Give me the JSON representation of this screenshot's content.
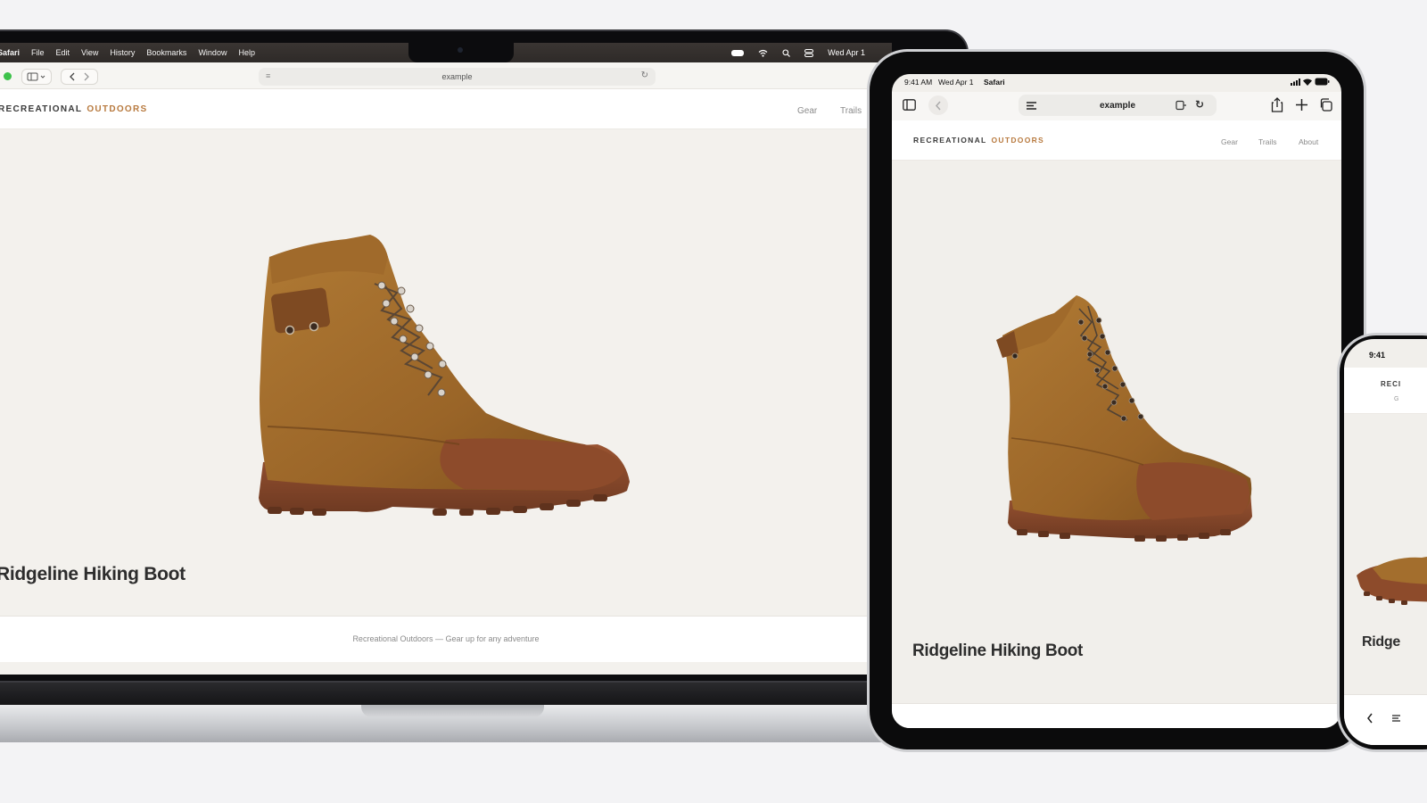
{
  "macbook": {
    "menubar": {
      "items": [
        "Safari",
        "File",
        "Edit",
        "View",
        "History",
        "Bookmarks",
        "Window",
        "Help"
      ],
      "clock": "Wed Apr 1"
    },
    "safari": {
      "url": "example"
    },
    "site": {
      "logo_main": "RECREATIONAL",
      "logo_accent": "OUTDOORS",
      "nav": [
        "Gear",
        "Trails"
      ],
      "product_title": "Ridgeline Hiking Boot",
      "footer": "Recreational Outdoors — Gear up for any adventure"
    }
  },
  "ipad": {
    "status": {
      "time": "9:41 AM",
      "date": "Wed Apr 1",
      "app": "Safari"
    },
    "safari": {
      "url": "example"
    },
    "site": {
      "logo_main": "RECREATIONAL",
      "logo_accent": "OUTDOORS",
      "nav": [
        "Gear",
        "Trails",
        "About"
      ],
      "product_title": "Ridgeline Hiking Boot"
    }
  },
  "iphone": {
    "status": {
      "time": "9:41"
    },
    "site": {
      "logo_partial": "RECI",
      "nav_partial": "G",
      "product_title_partial": "Ridge"
    }
  },
  "colors": {
    "logo_accent": "#b87a3f",
    "boot_leather": "#a36e2d",
    "boot_sole": "#8b4a2a",
    "page_bg": "#f1efeb"
  },
  "icons": [
    "sidebar-icon",
    "back-icon",
    "forward-icon",
    "reload-icon",
    "share-icon",
    "plus-icon",
    "tabs-icon",
    "wifi-icon",
    "search-icon",
    "battery-icon"
  ]
}
